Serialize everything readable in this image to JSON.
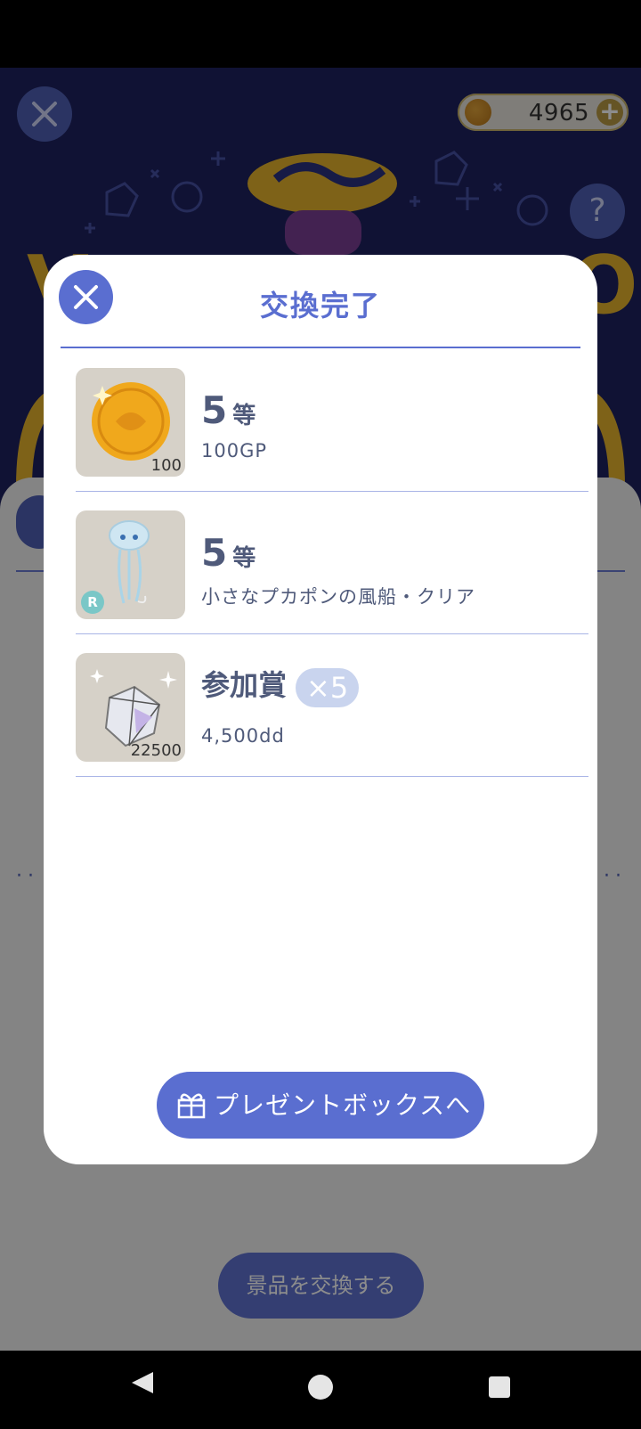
{
  "header": {
    "coins": "4965",
    "help_label": "?"
  },
  "modal": {
    "title": "交換完了",
    "items": [
      {
        "rank": "5",
        "rank_unit": "等",
        "description": "100GP",
        "quantity": "100",
        "badge": ""
      },
      {
        "rank": "5",
        "rank_unit": "等",
        "description": "小さなプカポンの風船・クリア",
        "quantity": "",
        "badge": "R"
      },
      {
        "rank": "参加賞",
        "rank_unit": "",
        "multiplier": "×5",
        "description": "4,500dd",
        "quantity": "22500",
        "badge": ""
      }
    ],
    "present_button": "プレゼントボックスへ"
  },
  "background": {
    "exchange_button": "景品を交換する"
  },
  "colors": {
    "accent": "#5a6ed0",
    "header_bg": "#1e2260",
    "text": "#4f5a7a"
  }
}
